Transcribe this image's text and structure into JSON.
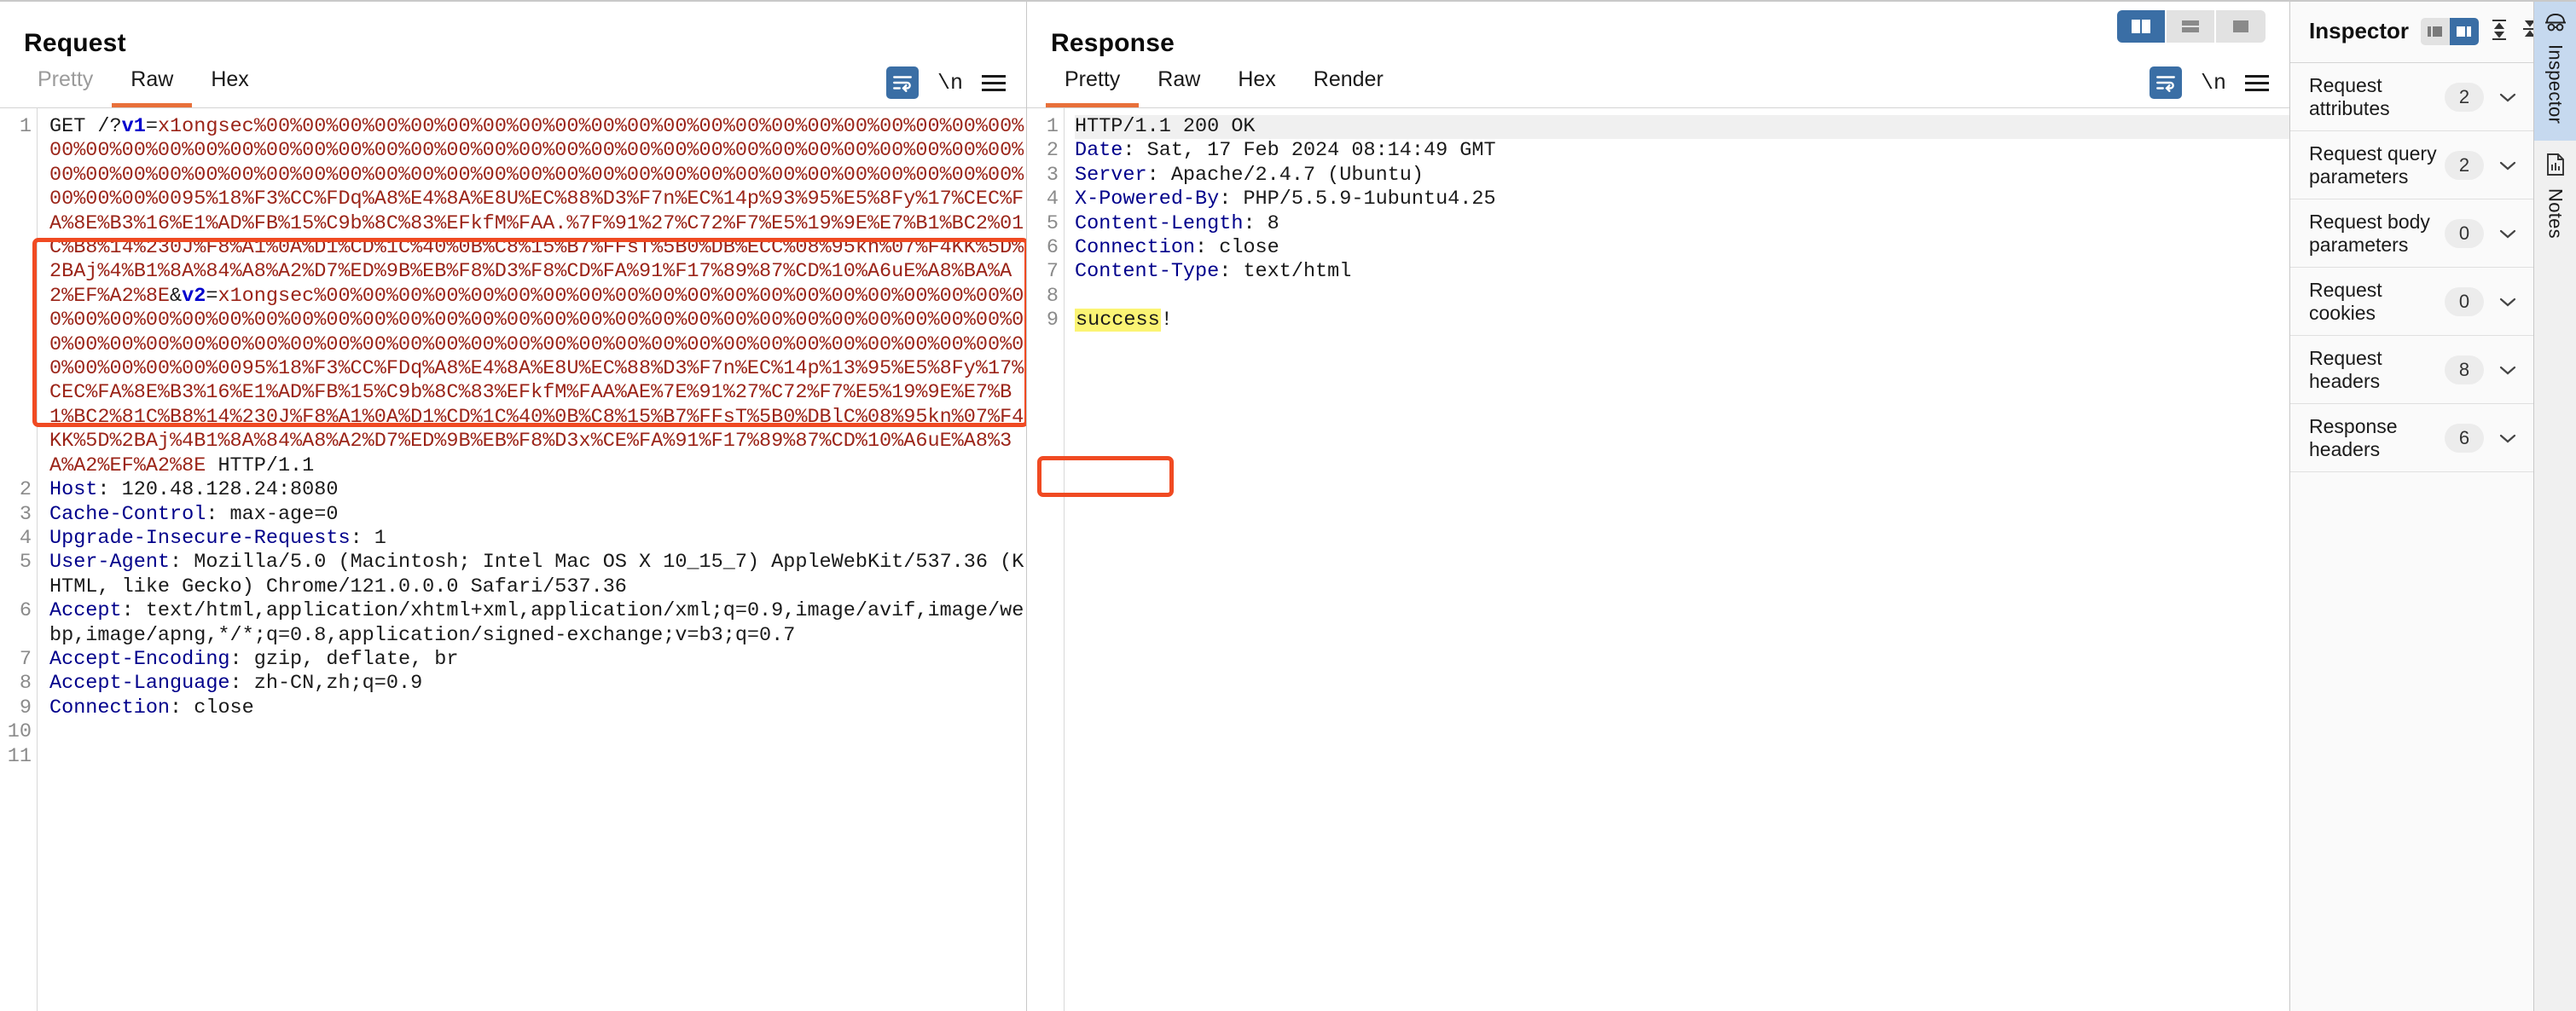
{
  "request": {
    "title": "Request",
    "tabs": [
      {
        "label": "Pretty",
        "active": false,
        "muted": true
      },
      {
        "label": "Raw",
        "active": true,
        "muted": false
      },
      {
        "label": "Hex",
        "active": false,
        "muted": false
      }
    ],
    "tools": [
      {
        "name": "word-wrap-icon",
        "active": true
      },
      {
        "name": "newline-icon",
        "label": "\\n",
        "active": false
      },
      {
        "name": "menu-icon",
        "active": false
      }
    ],
    "lines": [
      {
        "num": "1",
        "segments": [
          {
            "text": "GET /?",
            "kind": "plain"
          },
          {
            "text": "v1",
            "kind": "qparam"
          },
          {
            "text": "=",
            "kind": "plain"
          },
          {
            "text": "x1ongsec%00%00%00%00%00%00%00%00%00%00%00%00%00%00%00%00%00%00%00%00%00%00%00%00%00%00%00%00%00%00%00%00%00%00%00%00%00%00%00%00%00%00%00%00%00%00%00%00%00%00%00%00%00%00%00%00%00%00%00%00%00%00%00%00%00%00%00%00%00%00%00%00%00%00%00%00%00%00%0095%18%F3%CC%FDq%A8%E4%8A%E8U%EC%88%D3%F7n%EC%14p%93%95%E5%8Fy%17%CEC%FA%8E%B3%16%E1%AD%FB%15%C9b%8C%83%EFkfM%FAA.%7F%91%27%C72%F7%E5%19%9E%E7%B1%BC2%01C%B8%14%230J%F8%A1%0A%D1%CD%1C%40%0B%C8%15%B7%FFsT%5B0%DB%ECC%08%95kn%07%F4KK%5D%2BAj%4%B1%8A%84%A8%A2%D7%ED%9B%EB%F8%D3%F8%CD%FA%91%F17%89%87%CD%10%A6uE%A8%BA%A2%EF%A2%8E",
            "kind": "payload"
          },
          {
            "text": "&",
            "kind": "plain"
          },
          {
            "text": "v2",
            "kind": "qparam"
          },
          {
            "text": "=",
            "kind": "plain"
          },
          {
            "text": "x1ongsec%00%00%00%00%00%00%00%00%00%00%00%00%00%00%00%00%00%00%00%00%00%00%00%00%00%00%00%00%00%00%00%00%00%00%00%00%00%00%00%00%00%00%00%00%00%00%00%00%00%00%00%00%00%00%00%00%00%00%00%00%00%00%00%00%00%00%00%00%00%00%00%00%00%00%00%00%00%00%0095%18%F3%CC%FDq%A8%E4%8A%E8U%EC%88%D3%F7n%EC%14p%13%95%E5%8Fy%17%CEC%FA%8E%B3%16%E1%AD%FB%15%C9b%8C%83%EFkfM%FAA%AE%7E%91%27%C72%F7%E5%19%9E%E7%B1%BC2%81C%B8%14%230J%F8%A1%0A%D1%CD%1C%40%0B%C8%15%B7%FFsT%5B0%DBlC%08%95kn%07%F4KK%5D%2BAj%4B1%8A%84%A8%A2%D7%ED%9B%EB%F8%D3x%CE%FA%91%F17%89%87%CD%10%A6uE%A8%3A%A2%EF%A2%8E",
            "kind": "payload"
          },
          {
            "text": " HTTP/1.1",
            "kind": "plain"
          }
        ]
      },
      {
        "num": "2",
        "segments": [
          {
            "text": "Host",
            "kind": "hdr"
          },
          {
            "text": ": 120.48.128.24:8080",
            "kind": "plain"
          }
        ]
      },
      {
        "num": "3",
        "segments": [
          {
            "text": "Cache-Control",
            "kind": "hdr"
          },
          {
            "text": ": max-age=0",
            "kind": "plain"
          }
        ]
      },
      {
        "num": "4",
        "segments": [
          {
            "text": "Upgrade-Insecure-Requests",
            "kind": "hdr"
          },
          {
            "text": ": 1",
            "kind": "plain"
          }
        ]
      },
      {
        "num": "5",
        "segments": [
          {
            "text": "User-Agent",
            "kind": "hdr"
          },
          {
            "text": ": Mozilla/5.0 (Macintosh; Intel Mac OS X 10_15_7) AppleWebKit/537.36 (KHTML, like Gecko) Chrome/121.0.0.0 Safari/537.36",
            "kind": "plain"
          }
        ]
      },
      {
        "num": "6",
        "segments": [
          {
            "text": "Accept",
            "kind": "hdr"
          },
          {
            "text": ": text/html,application/xhtml+xml,application/xml;q=0.9,image/avif,image/webp,image/apng,*/*;q=0.8,application/signed-exchange;v=b3;q=0.7",
            "kind": "plain"
          }
        ]
      },
      {
        "num": "7",
        "segments": [
          {
            "text": "Accept-Encoding",
            "kind": "hdr"
          },
          {
            "text": ": gzip, deflate, br",
            "kind": "plain"
          }
        ]
      },
      {
        "num": "8",
        "segments": [
          {
            "text": "Accept-Language",
            "kind": "hdr"
          },
          {
            "text": ": zh-CN,zh;q=0.9",
            "kind": "plain"
          }
        ]
      },
      {
        "num": "9",
        "segments": [
          {
            "text": "Connection",
            "kind": "hdr"
          },
          {
            "text": ": close",
            "kind": "plain"
          }
        ]
      },
      {
        "num": "10",
        "segments": []
      },
      {
        "num": "11",
        "segments": []
      }
    ]
  },
  "response": {
    "title": "Response",
    "tabs": [
      {
        "label": "Pretty",
        "active": true,
        "muted": false
      },
      {
        "label": "Raw",
        "active": false,
        "muted": false
      },
      {
        "label": "Hex",
        "active": false,
        "muted": false
      },
      {
        "label": "Render",
        "active": false,
        "muted": false
      }
    ],
    "tools": [
      {
        "name": "word-wrap-icon",
        "active": true
      },
      {
        "name": "newline-icon",
        "label": "\\n",
        "active": false
      },
      {
        "name": "menu-icon",
        "active": false
      }
    ],
    "layout_toggles": [
      {
        "name": "side-by-side-layout-button",
        "active": true
      },
      {
        "name": "stacked-layout-button",
        "active": false
      },
      {
        "name": "single-pane-layout-button",
        "active": false
      }
    ],
    "lines": [
      {
        "num": "1",
        "highlight": true,
        "segments": [
          {
            "text": "HTTP/1.1 200 OK",
            "kind": "plain"
          }
        ]
      },
      {
        "num": "2",
        "segments": [
          {
            "text": "Date",
            "kind": "hdr"
          },
          {
            "text": ": Sat, 17 Feb 2024 08:14:49 GMT",
            "kind": "plain"
          }
        ]
      },
      {
        "num": "3",
        "segments": [
          {
            "text": "Server",
            "kind": "hdr"
          },
          {
            "text": ": Apache/2.4.7 (Ubuntu)",
            "kind": "plain"
          }
        ]
      },
      {
        "num": "4",
        "segments": [
          {
            "text": "X-Powered-By",
            "kind": "hdr"
          },
          {
            "text": ": PHP/5.5.9-1ubuntu4.25",
            "kind": "plain"
          }
        ]
      },
      {
        "num": "5",
        "segments": [
          {
            "text": "Content-Length",
            "kind": "hdr"
          },
          {
            "text": ": 8",
            "kind": "plain"
          }
        ]
      },
      {
        "num": "6",
        "segments": [
          {
            "text": "Connection",
            "kind": "hdr"
          },
          {
            "text": ": close",
            "kind": "plain"
          }
        ]
      },
      {
        "num": "7",
        "segments": [
          {
            "text": "Content-Type",
            "kind": "hdr"
          },
          {
            "text": ": text/html",
            "kind": "plain"
          }
        ]
      },
      {
        "num": "8",
        "segments": []
      },
      {
        "num": "9",
        "segments": [
          {
            "text": "success",
            "kind": "mark"
          },
          {
            "text": "!",
            "kind": "plain"
          }
        ]
      }
    ]
  },
  "inspector": {
    "title": "Inspector",
    "tools": [
      {
        "name": "layout-left-button",
        "active": false
      },
      {
        "name": "layout-right-button",
        "active": true
      },
      {
        "name": "expand-all-icon",
        "active": false
      },
      {
        "name": "collapse-all-icon",
        "active": false
      },
      {
        "name": "gear-icon",
        "active": false
      },
      {
        "name": "close-icon",
        "active": false
      }
    ],
    "rows": [
      {
        "label": "Request attributes",
        "count": "2"
      },
      {
        "label": "Request query parameters",
        "count": "2"
      },
      {
        "label": "Request body parameters",
        "count": "0"
      },
      {
        "label": "Request cookies",
        "count": "0"
      },
      {
        "label": "Request headers",
        "count": "8"
      },
      {
        "label": "Response headers",
        "count": "6"
      }
    ]
  },
  "rail": {
    "tabs": [
      {
        "label": "Inspector",
        "icon": "burp-detective-icon",
        "active": true
      },
      {
        "label": "Notes",
        "icon": "notes-document-icon",
        "active": false
      }
    ]
  },
  "colors": {
    "accent_orange": "#e8703a",
    "annotation_red": "#f04a22",
    "blue_active": "#3a6ea5",
    "header_blue": "#00008b",
    "payload_red": "#9b2418",
    "highlight_yellow": "#fbf474",
    "rail_selected": "#c6d9ef"
  }
}
